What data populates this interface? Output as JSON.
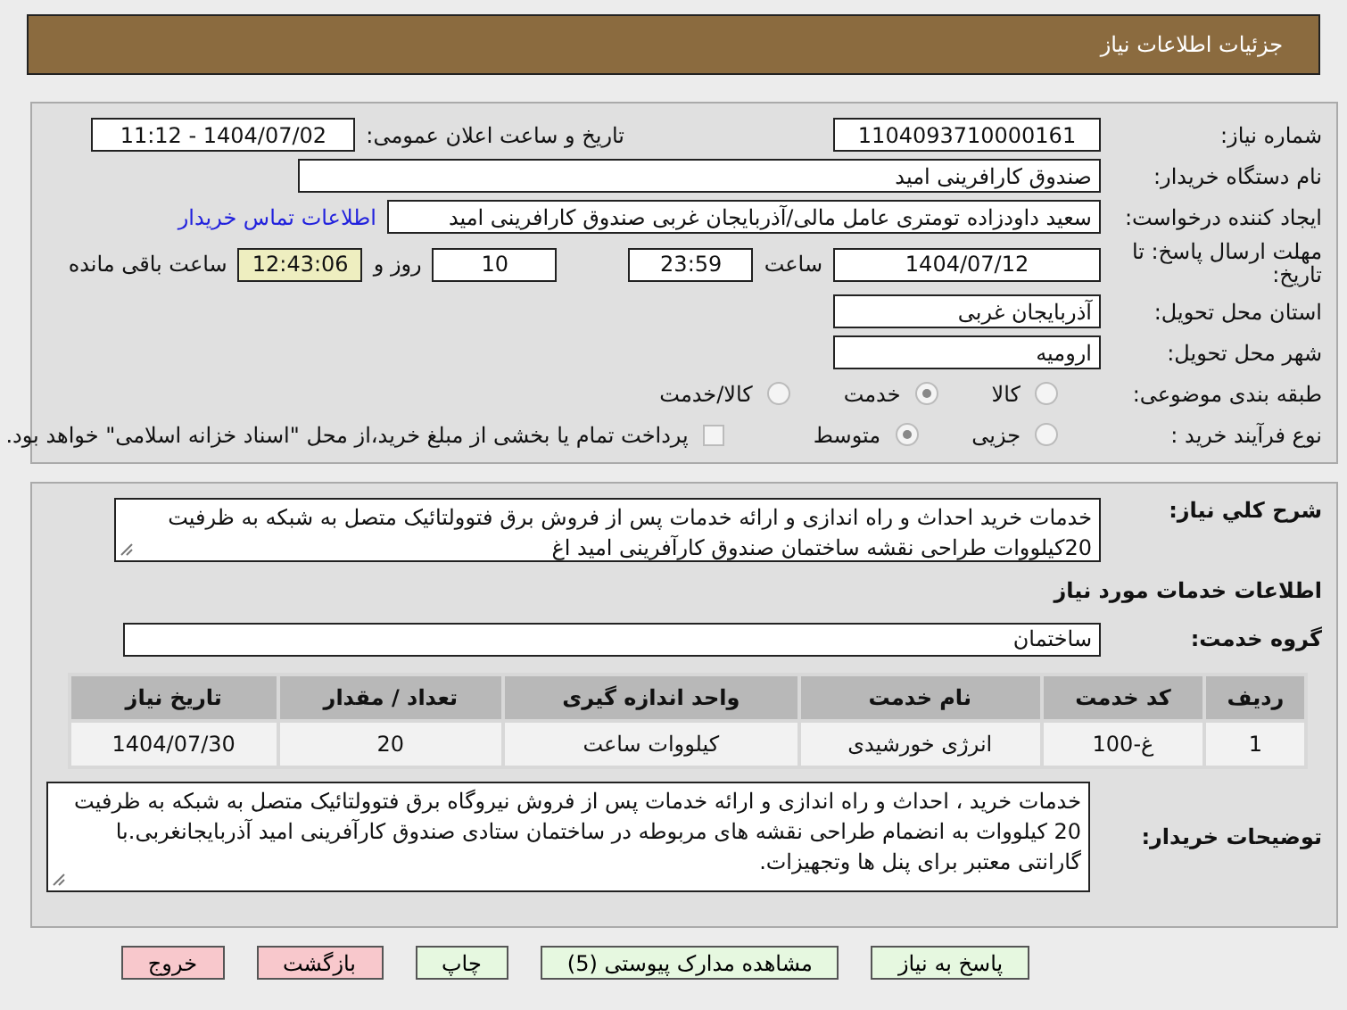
{
  "title": "جزئیات اطلاعات نیاز",
  "need_number": {
    "label": "شماره نیاز:",
    "value": "1104093710000161"
  },
  "announce": {
    "label": "تاریخ و ساعت اعلان عمومی:",
    "value": "1404/07/02 - 11:12"
  },
  "buyer_org": {
    "label": "نام دستگاه خریدار:",
    "value": "صندوق کارافرینی امید"
  },
  "requester": {
    "label": "ایجاد کننده درخواست:",
    "value": "سعید داودزاده تومتری عامل مالی/آذربایجان غربی صندوق کارافرینی امید",
    "link": "اطلاعات تماس خریدار"
  },
  "deadline": {
    "label": "مهلت ارسال پاسخ: تا تاریخ:",
    "date": "1404/07/12",
    "time_label": "ساعت",
    "time": "23:59",
    "days": "10",
    "days_label": "روز و",
    "remaining": "12:43:06",
    "remaining_label": "ساعت باقی مانده"
  },
  "province": {
    "label": "استان محل تحویل:",
    "value": "آذربایجان غربی"
  },
  "city": {
    "label": "شهر محل تحویل:",
    "value": "ارومیه"
  },
  "category": {
    "label": "طبقه بندی موضوعی:",
    "options": [
      {
        "label": "کالا",
        "selected": false
      },
      {
        "label": "خدمت",
        "selected": true
      },
      {
        "label": "کالا/خدمت",
        "selected": false
      }
    ]
  },
  "process": {
    "label": "نوع فرآیند خرید :",
    "options": [
      {
        "label": "جزیی",
        "selected": false
      },
      {
        "label": "متوسط",
        "selected": true
      }
    ],
    "payment": {
      "checked": false,
      "text": "پرداخت تمام یا بخشی از مبلغ خرید،از محل \"اسناد خزانه اسلامی\" خواهد بود."
    }
  },
  "description": {
    "label": "شرح کلي نياز:",
    "text": "خدمات خرید احداث و راه اندازی و ارائه خدمات پس از فروش برق فتوولتائیک متصل به شبکه به ظرفیت 20کیلووات طراحی نقشه  ساختمان صندوق کارآفرینی امید اغ"
  },
  "services_heading": "اطلاعات خدمات مورد نیاز",
  "service_group": {
    "label": "گروه خدمت:",
    "value": "ساختمان"
  },
  "table": {
    "columns": [
      "ردیف",
      "کد خدمت",
      "نام خدمت",
      "واحد اندازه گیری",
      "تعداد / مقدار",
      "تاریخ نیاز"
    ],
    "rows": [
      [
        "1",
        "غ-100",
        "انرژی خورشیدی",
        "کیلووات ساعت",
        "20",
        "1404/07/30"
      ]
    ]
  },
  "buyer_notes": {
    "label": "توضیحات خریدار:",
    "text": "خدمات خرید ، احداث و راه اندازی و ارائه خدمات پس از فروش نیروگاه برق فتوولتائیک متصل به شبکه به ظرفیت 20   کیلووات به انضمام طراحی نقشه های مربوطه در ساختمان ستادی صندوق کارآفرینی امید آذربایجانغربی.با گارانتی معتبر برای پنل ها وتجهیزات."
  },
  "buttons": [
    {
      "label": "پاسخ به نیاز",
      "kind": "normal"
    },
    {
      "label": "مشاهده مدارک پیوستی (5)",
      "kind": "normal"
    },
    {
      "label": "چاپ",
      "kind": "normal"
    },
    {
      "label": "بازگشت",
      "kind": "danger"
    },
    {
      "label": "خروج",
      "kind": "danger"
    }
  ]
}
